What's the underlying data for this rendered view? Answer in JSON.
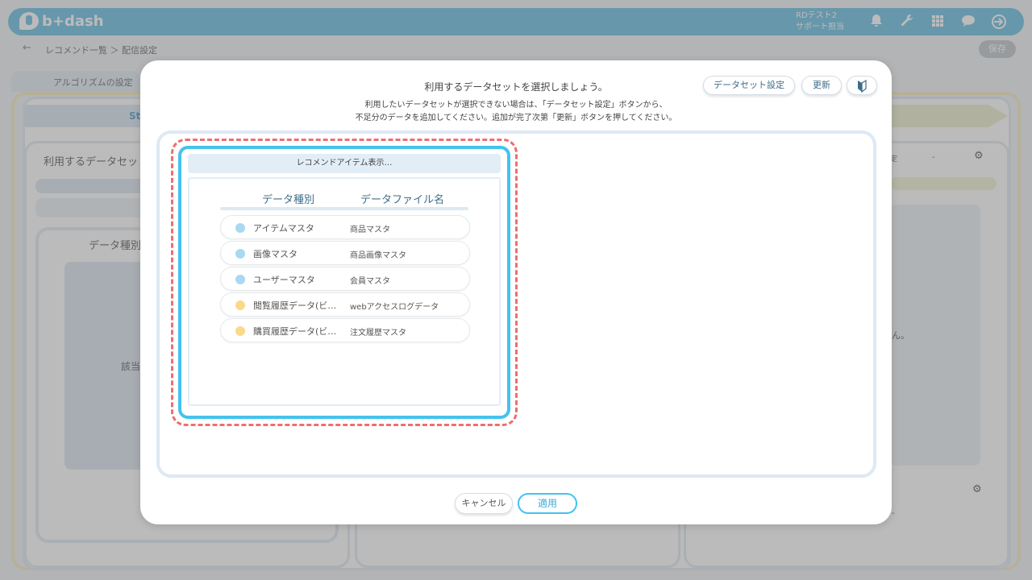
{
  "app": {
    "logo_text": "b+dash",
    "user_line1": "RDテスト2",
    "user_line2": "サポート担当",
    "icons": [
      "bell-icon",
      "wrench-icon",
      "grid-icon",
      "chat-icon",
      "logout-icon"
    ]
  },
  "breadcrumb": {
    "text": "レコメンド一覧 ＞ 配信設定",
    "save_label": "保存"
  },
  "background": {
    "tab_label": "アルゴリズムの設定",
    "step_label": "St",
    "section_label": "利用するデータセッ",
    "column_label": "データ種別",
    "empty_label": "該当",
    "right_select_prefix": "定",
    "right_select_value": "-",
    "right_fragment": "ん。",
    "right_select2_value": "-"
  },
  "modal": {
    "title": "利用するデータセットを選択しましょう。",
    "desc_line1": "利用したいデータセットが選択できない場合は、「データセット設定」ボタンから、",
    "desc_line2": "不足分のデータを追加してください。追加が完了次第「更新」ボタンを押してください。",
    "dataset_settings_label": "データセット設定",
    "refresh_label": "更新",
    "cancel_label": "キャンセル",
    "apply_label": "適用",
    "card": {
      "title": "レコメンドアイテム表示…",
      "col_type": "データ種別",
      "col_file": "データファイル名",
      "rows": [
        {
          "type": "アイテムマスタ",
          "file": "商品マスタ",
          "color": "#a9d8f3"
        },
        {
          "type": "画像マスタ",
          "file": "商品画像マスタ",
          "color": "#a9d8f3"
        },
        {
          "type": "ユーザーマスタ",
          "file": "会員マスタ",
          "color": "#a9d8f3"
        },
        {
          "type": "閲覧履歴データ(ビ…",
          "file": "webアクセスログデータ",
          "color": "#fbd98a"
        },
        {
          "type": "購買履歴データ(ビ…",
          "file": "注文履歴マスタ",
          "color": "#fbd98a"
        }
      ]
    }
  }
}
